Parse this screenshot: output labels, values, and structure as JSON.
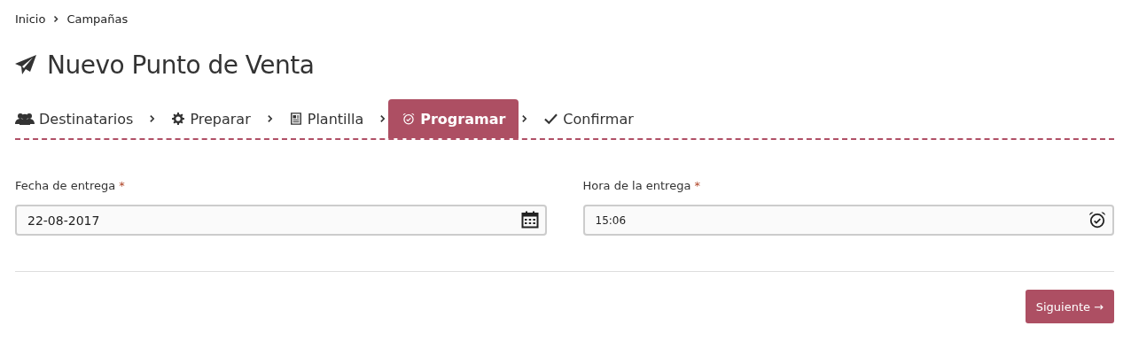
{
  "breadcrumb": [
    {
      "label": "Inicio"
    },
    {
      "label": "Campañas"
    }
  ],
  "title": "Nuevo Punto de Venta",
  "steps": [
    {
      "label": "Destinatarios",
      "kind": "users",
      "selected": false
    },
    {
      "label": "Preparar",
      "kind": "gear",
      "selected": false
    },
    {
      "label": "Plantilla",
      "kind": "document",
      "selected": false
    },
    {
      "label": "Programar",
      "kind": "alarm",
      "selected": true
    },
    {
      "label": "Confirmar",
      "kind": "check",
      "selected": false
    }
  ],
  "fields": [
    {
      "label": "Fecha de entrega",
      "required_mark": "*",
      "value": "22-08-2017",
      "kind": "calendar"
    },
    {
      "label": "Hora de la entrega",
      "required_mark": "*",
      "value": "15:06",
      "kind": "alarm"
    }
  ],
  "next_button": "Siguiente →"
}
